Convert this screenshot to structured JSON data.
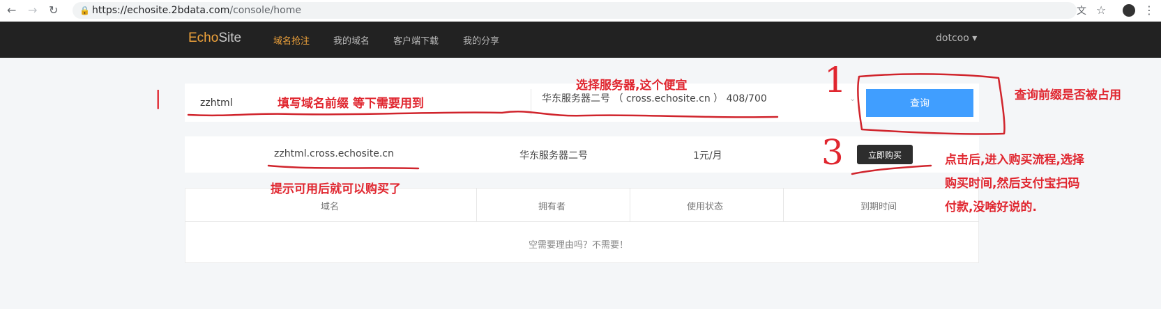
{
  "browser": {
    "url_host": "https://echosite.2bdata.com",
    "url_path": "/console/home"
  },
  "navbar": {
    "brand_echo": "Echo",
    "brand_site": "Site",
    "items": [
      {
        "label": "域名抢注",
        "active": true
      },
      {
        "label": "我的域名",
        "active": false
      },
      {
        "label": "客户端下载",
        "active": false
      },
      {
        "label": "我的分享",
        "active": false
      }
    ],
    "user": "dotcoo ▾"
  },
  "search": {
    "domain_value": "zzhtml",
    "server_value": "华东服务器二号 （ cross.echosite.cn ） 408/700",
    "query_label": "查询"
  },
  "result": {
    "domain": "zzhtml.cross.echosite.cn",
    "server": "华东服务器二号",
    "price": "1元/月",
    "buy_label": "立即购买"
  },
  "table": {
    "headers": [
      "域名",
      "拥有者",
      "使用状态",
      "到期时间"
    ],
    "empty_text": "空需要理由吗？不需要！"
  },
  "annotations": {
    "mark_1_left": "|",
    "mark_1": "1",
    "mark_3": "3",
    "fill_prefix": "填写域名前缀  等下需要用到",
    "choose_server": "选择服务器,这个便宜",
    "query_hint": "查询前缀是否被占用",
    "available_hint": "提示可用后就可以购买了",
    "buy_flow_line1": "点击后,进入购买流程,选择",
    "buy_flow_line2": "购买时间,然后支付宝扫码",
    "buy_flow_line3": "付款,没啥好说的."
  },
  "colors": {
    "accent": "#f0a33b",
    "primary_button": "#409eff",
    "annotation": "#e0262f",
    "navbar": "#222222"
  }
}
